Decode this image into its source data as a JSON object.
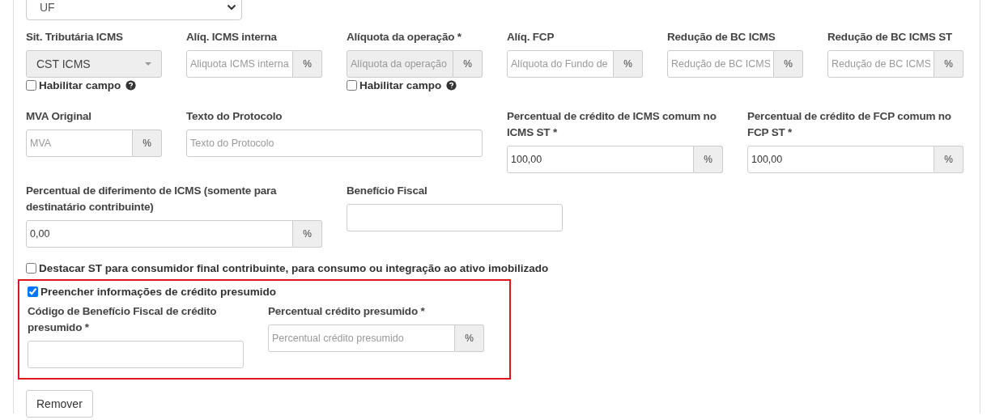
{
  "top_select": {
    "value": "UF"
  },
  "rows": [
    {
      "fields": [
        {
          "kind": "select",
          "label": "Sit. Tributária ICMS",
          "value": "CST ICMS",
          "disabled": true,
          "checkbox": {
            "label": "Habilitar campo",
            "checked": false
          }
        },
        {
          "kind": "addon",
          "label": "Alíq. ICMS interna",
          "placeholder": "Aliquota ICMS interna",
          "addon": "%",
          "disabled": false
        },
        {
          "kind": "addon",
          "label": "Alíquota da operação *",
          "placeholder": "Alíquota da operação",
          "addon": "%",
          "disabled": true,
          "checkbox": {
            "label": "Habilitar campo",
            "checked": false
          }
        },
        {
          "kind": "addon",
          "label": "Alíq. FCP",
          "placeholder": "Alíquota do Fundo de",
          "addon": "%",
          "disabled": false
        },
        {
          "kind": "addon",
          "label": "Redução de BC ICMS",
          "placeholder": "Redução de BC ICMS",
          "addon": "%",
          "disabled": false
        },
        {
          "kind": "addon",
          "label": "Redução de BC ICMS ST",
          "placeholder": "Redução de BC ICMS",
          "addon": "%",
          "disabled": false
        }
      ]
    },
    {
      "fields": [
        {
          "kind": "addon",
          "label": "MVA Original",
          "placeholder": "MVA",
          "addon": "%",
          "disabled": false
        },
        {
          "kind": "text",
          "label": "Texto do Protocolo",
          "placeholder": "Texto do Protocolo",
          "disabled": false
        },
        {
          "kind": "addon",
          "label": "Percentual de crédito de ICMS comum no ICMS ST *",
          "value": "100,00",
          "addon": "%",
          "disabled": false
        },
        {
          "kind": "addon",
          "label": "Percentual de crédito de FCP comum no FCP ST *",
          "value": "100,00",
          "addon": "%",
          "disabled": false
        }
      ]
    },
    {
      "fields": [
        {
          "kind": "addon",
          "label": "Percentual de diferimento de ICMS (somente para destinatário contribuinte)",
          "value": "0,00",
          "addon": "%",
          "disabled": false
        },
        {
          "kind": "text",
          "label": "Benefício Fiscal",
          "disabled": false
        }
      ]
    }
  ],
  "destacar": {
    "label": "Destacar ST para consumidor final contribuinte, para consumo ou integração ao ativo imobilizado",
    "checked": false
  },
  "credito": {
    "highlighted": true,
    "checkbox": {
      "label": "Preencher informações de crédito presumido",
      "checked": true
    },
    "fields": [
      {
        "kind": "text",
        "label": "Código de Benefício Fiscal de crédito presumido *",
        "disabled": false
      },
      {
        "kind": "addon",
        "label": "Percentual crédito presumido *",
        "placeholder": "Percentual crédito presumido",
        "addon": "%",
        "disabled": false
      }
    ]
  },
  "button": "Remover"
}
